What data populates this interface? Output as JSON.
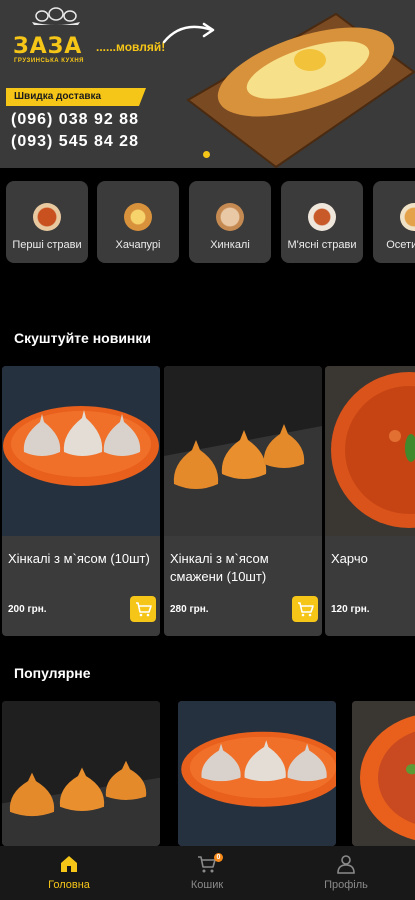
{
  "banner": {
    "brand": "ЗАЗА",
    "brand_suffix": "......мовляй!",
    "tagline": "ГРУЗИНСЬКА КУХНЯ",
    "delivery": "Швидка доставка",
    "phones": [
      "(096) 038 92 88",
      "(093) 545 84 28"
    ]
  },
  "categories": [
    {
      "label": "Перші страви"
    },
    {
      "label": "Хачапурі"
    },
    {
      "label": "Хинкалі"
    },
    {
      "label": "М'ясні страви"
    },
    {
      "label": "Осетинські"
    }
  ],
  "sections": {
    "new": "Скуштуйте новинки",
    "popular": "Популярне"
  },
  "new_items": [
    {
      "name": "Хінкалі з м`ясом (10шт)",
      "price": "200 грн."
    },
    {
      "name": "Хінкалі з м`ясом смажени (10шт)",
      "price": "280 грн."
    },
    {
      "name": "Харчо",
      "price": "120 грн."
    }
  ],
  "tabbar": {
    "home": "Головна",
    "cart": "Кошик",
    "cart_count": "0",
    "profile": "Профіль"
  },
  "colors": {
    "accent": "#f5c518",
    "card_bg": "#3b3b3b",
    "tab_active": "#f5c518",
    "tab_inactive": "#8a8a8a"
  }
}
